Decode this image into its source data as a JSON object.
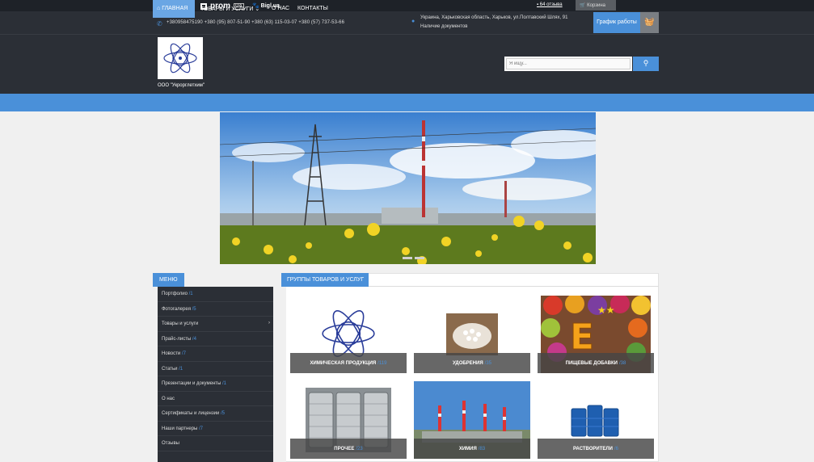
{
  "topbar": {
    "brand": "prom",
    "brand_badge": "UA",
    "partner": "Bigl.ua",
    "reviews": "64 отзыва",
    "cart": "Корзина"
  },
  "header": {
    "phones": "+380958475190   +380 (95) 807-51-90   +380 (63) 115-03-07   +380 (57) 737-53-66",
    "address": "Украина, Харьковская область, Харьков, ул.Полтавский Шлях, 91",
    "docs": "Наличие документов",
    "schedule": "График работы",
    "company": "ООО \"Укрорглетхим\"",
    "search_placeholder": "Я ищу..."
  },
  "nav": {
    "items": [
      "ГЛАВНАЯ",
      "ТОВАРЫ И УСЛУГИ",
      "О НАС",
      "КОНТАКТЫ"
    ]
  },
  "menu": {
    "title": "МЕНЮ",
    "items": [
      {
        "label": "Портфолио",
        "count": "/1"
      },
      {
        "label": "Фотогалерея",
        "count": "/5"
      },
      {
        "label": "Товары и услуги",
        "count": ""
      },
      {
        "label": "Прайс-листы",
        "count": "/4"
      },
      {
        "label": "Новости",
        "count": "/7"
      },
      {
        "label": "Статьи",
        "count": "/1"
      },
      {
        "label": "Презентации и документы",
        "count": "/1"
      },
      {
        "label": "О нас",
        "count": ""
      },
      {
        "label": "Сертификаты и лицензии",
        "count": "/5"
      },
      {
        "label": "Наши партнеры",
        "count": "/7"
      },
      {
        "label": "Отзывы",
        "count": ""
      }
    ]
  },
  "groups": {
    "title": "ГРУППЫ ТОВАРОВ И УСЛУГ",
    "tiles": [
      {
        "label": "Химическая продукция",
        "count": "/119"
      },
      {
        "label": "Удобрения",
        "count": "/35"
      },
      {
        "label": "Пищевые добавки",
        "count": "/38"
      },
      {
        "label": "Прочее",
        "count": "/23"
      },
      {
        "label": "Химия",
        "count": "/83"
      },
      {
        "label": "Растворители",
        "count": "/6"
      }
    ]
  },
  "colors": {
    "accent": "#4a90d9",
    "dark": "#2b2f36",
    "topbar": "#1e2228"
  }
}
